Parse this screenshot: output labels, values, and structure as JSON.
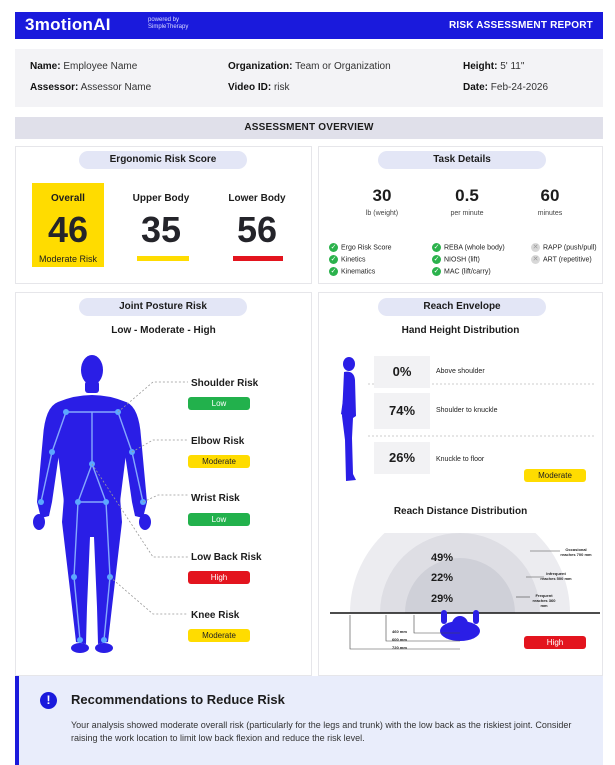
{
  "header": {
    "logo": "3motionAI",
    "powered_by_line1": "powered by",
    "powered_by_line2": "SimpleTherapy",
    "report_title": "RISK ASSESSMENT REPORT"
  },
  "info": {
    "name_label": "Name:",
    "name_value": "Employee Name",
    "assessor_label": "Assessor:",
    "assessor_value": "Assessor Name",
    "org_label": "Organization:",
    "org_value": "Team or Organization",
    "video_label": "Video ID:",
    "video_value": "risk",
    "height_label": "Height:",
    "height_value": "5' 11\"",
    "date_label": "Date:",
    "date_value": "Feb-24-2026"
  },
  "overview_title": "ASSESSMENT OVERVIEW",
  "ergo": {
    "title": "Ergonomic Risk Score",
    "overall_label": "Overall",
    "overall_value": "46",
    "overall_level": "Moderate Risk",
    "upper_label": "Upper Body",
    "upper_value": "35",
    "lower_label": "Lower Body",
    "lower_value": "56",
    "colors": {
      "overall": "#ffdc00",
      "upper": "#ffdc00",
      "lower": "#e3141e"
    }
  },
  "task": {
    "title": "Task Details",
    "stats": [
      {
        "value": "30",
        "unit": "lb (weight)"
      },
      {
        "value": "0.5",
        "unit": "per minute"
      },
      {
        "value": "60",
        "unit": "minutes"
      }
    ],
    "checks": [
      {
        "label": "Ergo Risk Score",
        "on": true
      },
      {
        "label": "Kinetics",
        "on": true
      },
      {
        "label": "Kinematics",
        "on": true
      },
      {
        "label": "REBA (whole body)",
        "on": true
      },
      {
        "label": "NIOSH (lift)",
        "on": true
      },
      {
        "label": "MAC (lift/carry)",
        "on": true
      },
      {
        "label": "RAPP (push/pull)",
        "on": false
      },
      {
        "label": "ART (repetitive)",
        "on": false
      }
    ]
  },
  "joint": {
    "title": "Joint Posture Risk",
    "subtitle": "Low - Moderate - High",
    "items": [
      {
        "label": "Shoulder Risk",
        "level": "Low"
      },
      {
        "label": "Elbow Risk",
        "level": "Moderate"
      },
      {
        "label": "Wrist Risk",
        "level": "Low"
      },
      {
        "label": "Low Back Risk",
        "level": "High"
      },
      {
        "label": "Knee Risk",
        "level": "Moderate"
      }
    ]
  },
  "reach": {
    "title": "Reach Envelope",
    "hand_title": "Hand Height Distribution",
    "hand_rows": [
      {
        "pct": "0%",
        "label": "Above shoulder"
      },
      {
        "pct": "74%",
        "label": "Shoulder to knuckle"
      },
      {
        "pct": "26%",
        "label": "Knuckle to floor"
      }
    ],
    "hand_level": "Moderate",
    "distance_title": "Reach Distance Distribution",
    "distance_pcts": [
      "49%",
      "22%",
      "29%"
    ],
    "zone_labels": [
      "Occasional reaches 700 mm",
      "Infrequent reaches 500 mm",
      "Frequent reaches 360 mm"
    ],
    "scale_labels": [
      "460 mm",
      "600 mm",
      "720 mm"
    ],
    "distance_level": "High"
  },
  "recommendation": {
    "icon": "!",
    "title": "Recommendations to Reduce Risk",
    "text": "Your analysis showed moderate overall risk (particularly for the legs and trunk) with the low back as the riskiest joint. Consider raising the work location to limit low back flexion and reduce the risk level."
  }
}
